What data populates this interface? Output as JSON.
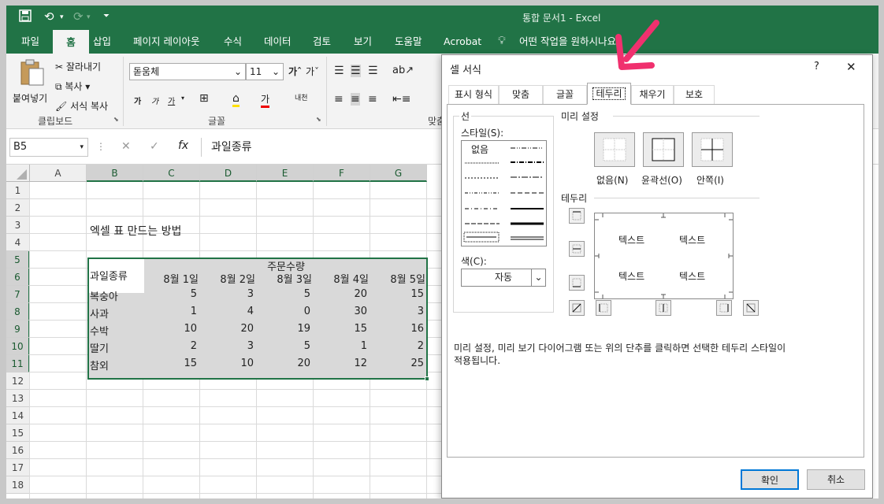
{
  "app": {
    "title": "통합 문서1 - Excel"
  },
  "tabs": [
    "파일",
    "홈",
    "삽입",
    "페이지 레이아웃",
    "수식",
    "데이터",
    "검토",
    "보기",
    "도움말",
    "Acrobat",
    "어떤 작업을 원하시나요"
  ],
  "ribbon": {
    "clipboard": {
      "paste": "붙여넣기",
      "cut": "잘라내기",
      "copy": "복사",
      "format_painter": "서식 복사",
      "group": "클립보드"
    },
    "font": {
      "name": "돋움체",
      "size": "11",
      "group": "글꼴"
    },
    "align_group_partial": "맞춤"
  },
  "formula_bar": {
    "name_box": "B5",
    "content": "과일종류"
  },
  "sheet": {
    "columns": [
      "A",
      "B",
      "C",
      "D",
      "E",
      "F",
      "G"
    ],
    "rows": [
      "1",
      "2",
      "3",
      "4",
      "5",
      "6",
      "7",
      "8",
      "9",
      "10",
      "11",
      "12",
      "13",
      "14",
      "15",
      "16",
      "17",
      "18"
    ],
    "title": "엑셀 표 만드는 방법",
    "header_fruit": "과일종류",
    "header_orders": "주문수량",
    "dates": [
      "8월  1일",
      "8월  2일",
      "8월  3일",
      "8월  4일",
      "8월  5일"
    ],
    "data": [
      {
        "name": "복숭아",
        "values": [
          "5",
          "3",
          "5",
          "20",
          "15"
        ]
      },
      {
        "name": "사과",
        "values": [
          "1",
          "4",
          "0",
          "30",
          "3"
        ]
      },
      {
        "name": "수박",
        "values": [
          "10",
          "20",
          "19",
          "15",
          "16"
        ]
      },
      {
        "name": "딸기",
        "values": [
          "2",
          "3",
          "5",
          "1",
          "2"
        ]
      },
      {
        "name": "참외",
        "values": [
          "15",
          "10",
          "20",
          "12",
          "25"
        ]
      }
    ]
  },
  "dialog": {
    "title": "셀 서식",
    "help": "?",
    "close": "✕",
    "tabs": [
      "표시 형식",
      "맞춤",
      "글꼴",
      "테두리",
      "채우기",
      "보호"
    ],
    "line_label": "선",
    "style_label": "스타일(S):",
    "none_style": "없음",
    "color_label": "색(C):",
    "color_value": "자동",
    "presets_label": "미리 설정",
    "presets": [
      "없음(N)",
      "윤곽선(O)",
      "안쪽(I)"
    ],
    "border_label": "테두리",
    "preview_text": "텍스트",
    "hint_line1": "미리 설정, 미리 보기 다이어그램 또는 위의 단추를 클릭하면 선택한 테두리 스타일이",
    "hint_line2": "적용됩니다.",
    "ok": "확인",
    "cancel": "취소"
  },
  "colors": {
    "accent": "#217346",
    "arrow": "#f0306e"
  }
}
